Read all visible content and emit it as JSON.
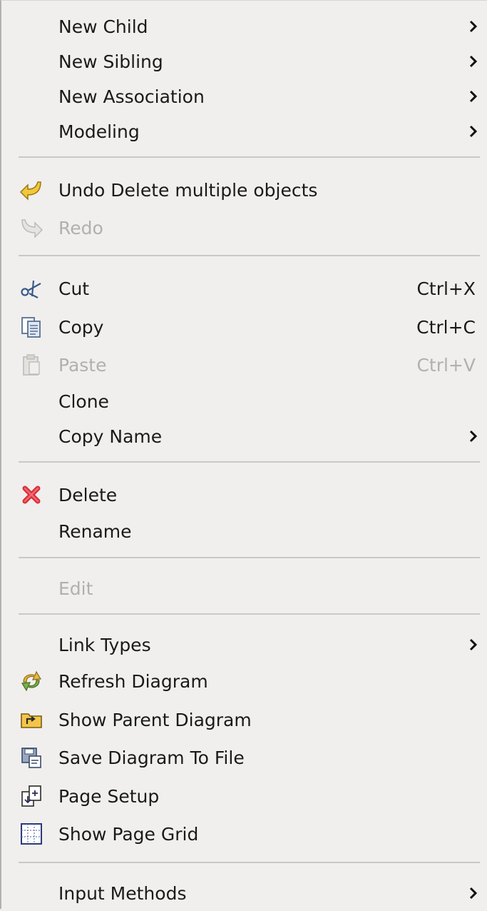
{
  "menu": {
    "new_child": "New Child",
    "new_sibling": "New Sibling",
    "new_association": "New Association",
    "modeling": "Modeling",
    "undo": "Undo Delete multiple objects",
    "redo": "Redo",
    "cut": "Cut",
    "cut_shortcut": "Ctrl+X",
    "copy": "Copy",
    "copy_shortcut": "Ctrl+C",
    "paste": "Paste",
    "paste_shortcut": "Ctrl+V",
    "clone": "Clone",
    "copy_name": "Copy Name",
    "delete": "Delete",
    "rename": "Rename",
    "edit": "Edit",
    "link_types": "Link Types",
    "refresh_diagram": "Refresh Diagram",
    "show_parent_diagram": "Show Parent Diagram",
    "save_diagram_to_file": "Save Diagram To File",
    "page_setup": "Page Setup",
    "show_page_grid": "Show Page Grid",
    "input_methods": "Input Methods"
  },
  "icons": {
    "undo": "undo-arrow-icon",
    "redo": "redo-arrow-icon",
    "cut": "scissors-icon",
    "copy": "copy-document-icon",
    "paste": "clipboard-icon",
    "delete": "red-x-icon",
    "refresh": "refresh-arrows-icon",
    "show_parent": "folder-up-icon",
    "save": "floppy-disk-icon",
    "page_setup": "page-setup-icon",
    "page_grid": "grid-icon",
    "submenu": "chevron-right-icon"
  },
  "colors": {
    "background": "#f0efee",
    "text": "#1a1a1a",
    "disabled_text": "#b2b0ad",
    "separator": "#cbc8c4",
    "delete_icon": "#d9303a",
    "undo_icon": "#f2c73a"
  }
}
